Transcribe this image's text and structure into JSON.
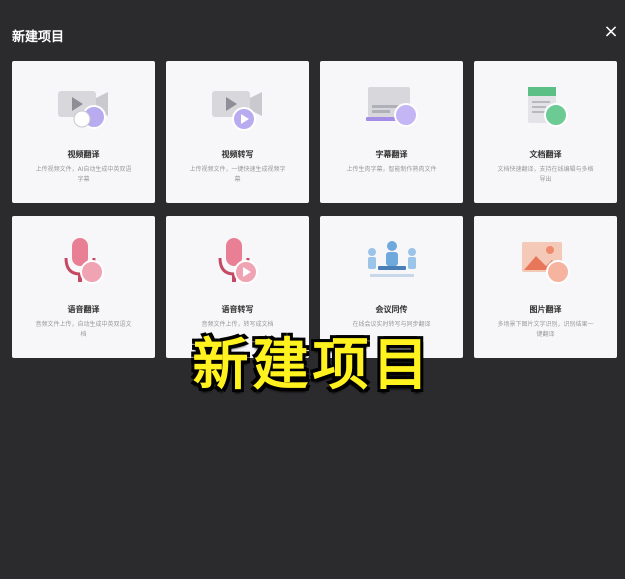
{
  "dialog": {
    "title": "新建项目",
    "close_symbol": "×"
  },
  "cards": [
    {
      "title": "视频翻译",
      "desc": "上传视频文件，AI自动生成中英双语字幕",
      "icon": "video-translate-icon"
    },
    {
      "title": "视频转写",
      "desc": "上传视频文件，一键快速生成视频字幕",
      "icon": "video-transcribe-icon"
    },
    {
      "title": "字幕翻译",
      "desc": "上传生肉字幕，智能制作熟肉文件",
      "icon": "subtitle-translate-icon"
    },
    {
      "title": "文档翻译",
      "desc": "文档快速翻译，支持在线编辑与多格导出",
      "icon": "document-translate-icon"
    },
    {
      "title": "语音翻译",
      "desc": "音频文件上传，自动生成中英双语文档",
      "icon": "audio-translate-icon"
    },
    {
      "title": "语音转写",
      "desc": "音频文件上传，转写成文档",
      "icon": "audio-transcribe-icon"
    },
    {
      "title": "会议同传",
      "desc": "在线会议实时转写与同步翻译",
      "icon": "meeting-interpret-icon"
    },
    {
      "title": "图片翻译",
      "desc": "多场景下图片文字识别，识别结果一键翻译",
      "icon": "image-translate-icon"
    }
  ],
  "overlay": {
    "caption": "新建项目"
  },
  "colors": {
    "background": "#2b2a2d",
    "card": "#f7f7f9",
    "caption": "#fff21e",
    "accent_purple": "#9c8ae6",
    "accent_green": "#4caf7a",
    "accent_pink": "#e0607a"
  }
}
